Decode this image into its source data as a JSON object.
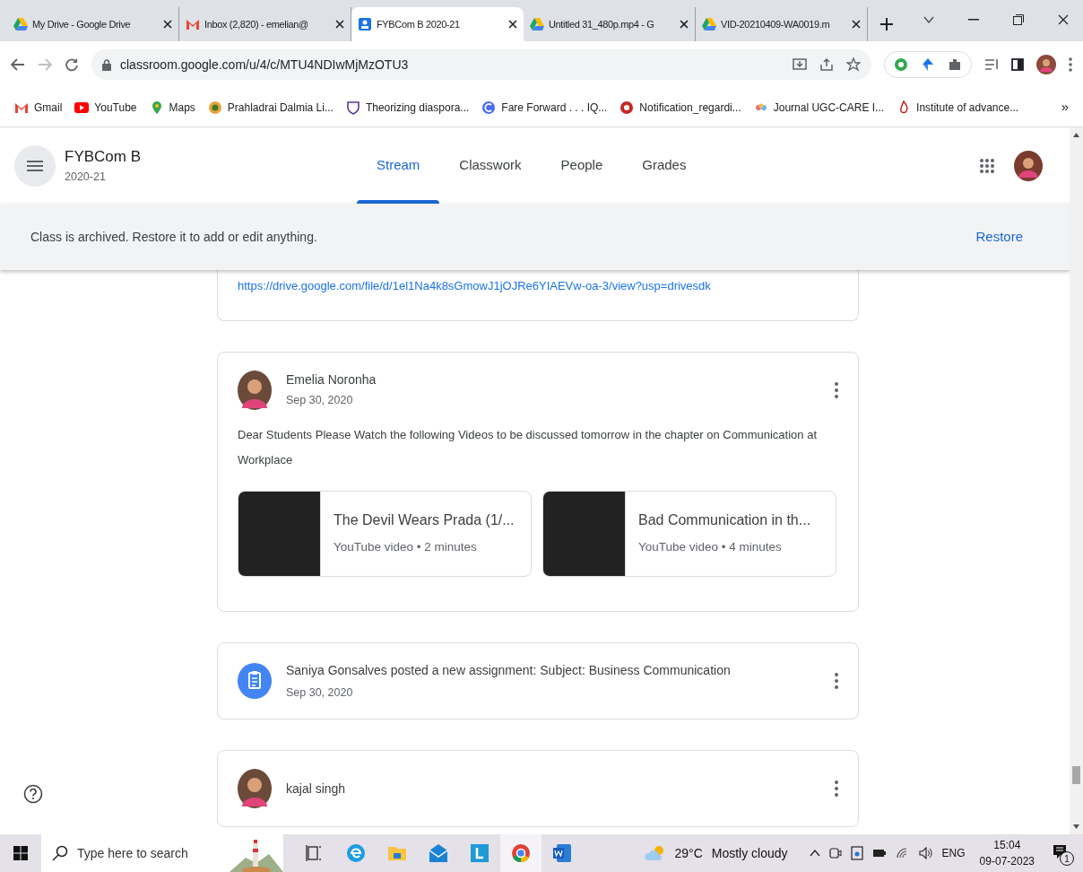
{
  "browser": {
    "tabs": [
      {
        "title": "My Drive - Google Drive",
        "selected": false
      },
      {
        "title": "Inbox (2,820) - emelian@",
        "selected": false
      },
      {
        "title": "FYBCom B 2020-21",
        "selected": true
      },
      {
        "title": "Untitled 31_480p.mp4 - G",
        "selected": false
      },
      {
        "title": "VID-20210409-WA0019.m",
        "selected": false
      }
    ],
    "url": "classroom.google.com/u/4/c/MTU4NDIwMjMzOTU3",
    "bookmarks": [
      {
        "label": "Gmail"
      },
      {
        "label": "YouTube"
      },
      {
        "label": "Maps"
      },
      {
        "label": "Prahladrai Dalmia Li..."
      },
      {
        "label": "Theorizing diaspora..."
      },
      {
        "label": "Fare Forward . . . IQ..."
      },
      {
        "label": "Notification_regardi..."
      },
      {
        "label": "Journal UGC-CARE I..."
      },
      {
        "label": "Institute of advance..."
      }
    ],
    "bookmarks_more": "»"
  },
  "classroom": {
    "class_name": "FYBCom B",
    "section": "2020-21",
    "nav": [
      {
        "label": "Stream",
        "selected": true
      },
      {
        "label": "Classwork",
        "selected": false
      },
      {
        "label": "People",
        "selected": false
      },
      {
        "label": "Grades",
        "selected": false
      }
    ],
    "banner": {
      "text": "Class is archived. Restore it to add or edit anything.",
      "action": "Restore"
    },
    "stream": [
      {
        "kind": "link",
        "url": "https://drive.google.com/file/d/1el1Na4k8sGmowJ1jOJRe6YIAEVw-oa-3/view?usp=drivesdk"
      },
      {
        "kind": "post",
        "author": "Emelia Noronha",
        "date": "Sep 30, 2020",
        "body": "Dear Students Please Watch the following Videos to be discussed tomorrow in the chapter on Communication at Workplace",
        "attachments": [
          {
            "title": "The Devil Wears Prada (1/...",
            "meta": "YouTube video • 2 minutes"
          },
          {
            "title": "Bad Communication in th...",
            "meta": "YouTube video • 4 minutes"
          }
        ]
      },
      {
        "kind": "assignment",
        "text": "Saniya Gonsalves posted a new assignment: Subject: Business Communication",
        "date": "Sep 30, 2020"
      },
      {
        "kind": "post",
        "author": "kajal singh"
      }
    ]
  },
  "taskbar": {
    "search_placeholder": "Type here to search",
    "temperature": "29°C",
    "weather": "Mostly cloudy",
    "language": "ENG",
    "time": "15:04",
    "date": "09-07-2023",
    "notifications": "1"
  }
}
